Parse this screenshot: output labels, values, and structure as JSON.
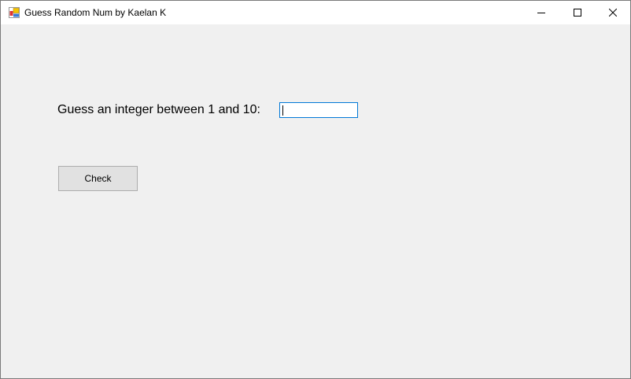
{
  "window": {
    "title": "Guess Random Num by Kaelan K",
    "icon": "winforms-app-icon"
  },
  "controls": {
    "minimize": "minimize-icon",
    "maximize": "maximize-icon",
    "close": "close-icon"
  },
  "form": {
    "prompt_label": "Guess an integer between 1 and 10:",
    "guess_value": "",
    "check_label": "Check"
  },
  "colors": {
    "focus_border": "#0078d7",
    "background": "#f0f0f0"
  }
}
